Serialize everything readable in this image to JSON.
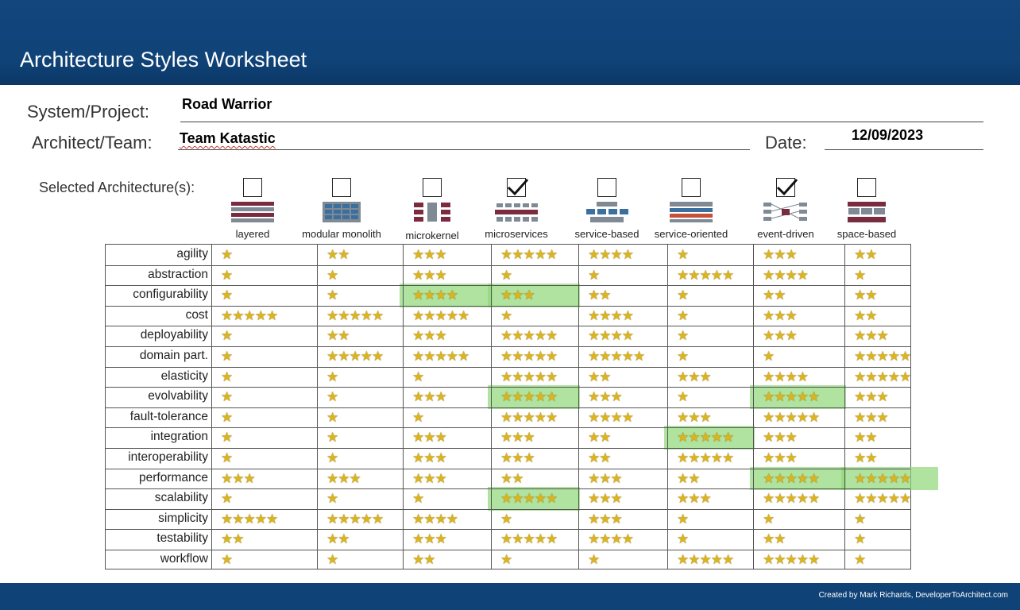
{
  "header": {
    "title": "Architecture Styles Worksheet"
  },
  "form": {
    "project_label": "System/Project:",
    "project_value": "Road Warrior",
    "architect_label": "Architect/Team:",
    "architect_value": "Team Katastic",
    "date_label": "Date:",
    "date_value": "12/09/2023",
    "selected_label": "Selected Architecture(s):"
  },
  "styles": [
    {
      "name": "layered",
      "selected": false
    },
    {
      "name": "modular monolith",
      "selected": false
    },
    {
      "name": "microkernel",
      "selected": false
    },
    {
      "name": "microservices",
      "selected": true
    },
    {
      "name": "service-based",
      "selected": false
    },
    {
      "name": "service-oriented",
      "selected": false
    },
    {
      "name": "event-driven",
      "selected": true
    },
    {
      "name": "space-based",
      "selected": false
    }
  ],
  "ratings": [
    {
      "characteristic": "agility",
      "stars": [
        1,
        2,
        3,
        5,
        4,
        1,
        3,
        2
      ]
    },
    {
      "characteristic": "abstraction",
      "stars": [
        1,
        1,
        3,
        1,
        1,
        5,
        4,
        1
      ]
    },
    {
      "characteristic": "configurability",
      "stars": [
        1,
        1,
        4,
        3,
        2,
        1,
        2,
        2
      ]
    },
    {
      "characteristic": "cost",
      "stars": [
        5,
        5,
        5,
        1,
        4,
        1,
        3,
        2
      ]
    },
    {
      "characteristic": "deployability",
      "stars": [
        1,
        2,
        3,
        5,
        4,
        1,
        3,
        3
      ]
    },
    {
      "characteristic": "domain part.",
      "stars": [
        1,
        5,
        5,
        5,
        5,
        1,
        1,
        5
      ]
    },
    {
      "characteristic": "elasticity",
      "stars": [
        1,
        1,
        1,
        5,
        2,
        3,
        4,
        5
      ]
    },
    {
      "characteristic": "evolvability",
      "stars": [
        1,
        1,
        3,
        5,
        3,
        1,
        5,
        3
      ]
    },
    {
      "characteristic": "fault-tolerance",
      "stars": [
        1,
        1,
        1,
        5,
        4,
        3,
        5,
        3
      ]
    },
    {
      "characteristic": "integration",
      "stars": [
        1,
        1,
        3,
        3,
        2,
        5,
        3,
        2
      ]
    },
    {
      "characteristic": "interoperability",
      "stars": [
        1,
        1,
        3,
        3,
        2,
        5,
        3,
        2
      ]
    },
    {
      "characteristic": "performance",
      "stars": [
        3,
        3,
        3,
        2,
        3,
        2,
        5,
        5
      ]
    },
    {
      "characteristic": "scalability",
      "stars": [
        1,
        1,
        1,
        5,
        3,
        3,
        5,
        5
      ]
    },
    {
      "characteristic": "simplicity",
      "stars": [
        5,
        5,
        4,
        1,
        3,
        1,
        1,
        1
      ]
    },
    {
      "characteristic": "testability",
      "stars": [
        2,
        2,
        3,
        5,
        4,
        1,
        2,
        1
      ]
    },
    {
      "characteristic": "workflow",
      "stars": [
        1,
        1,
        2,
        1,
        1,
        5,
        5,
        1
      ]
    }
  ],
  "highlights": [
    {
      "row": 2,
      "col": 2
    },
    {
      "row": 2,
      "col": 3
    },
    {
      "row": 7,
      "col": 3
    },
    {
      "row": 7,
      "col": 6
    },
    {
      "row": 9,
      "col": 5
    },
    {
      "row": 11,
      "col": 6
    },
    {
      "row": 11,
      "col": 7
    },
    {
      "row": 12,
      "col": 3
    }
  ],
  "colors": {
    "header_bg": "#12467c",
    "highlight": "#8fd777",
    "star": "#dcb41e"
  },
  "footer": {
    "credit": "Created by Mark Richards, DeveloperToArchitect.com"
  }
}
